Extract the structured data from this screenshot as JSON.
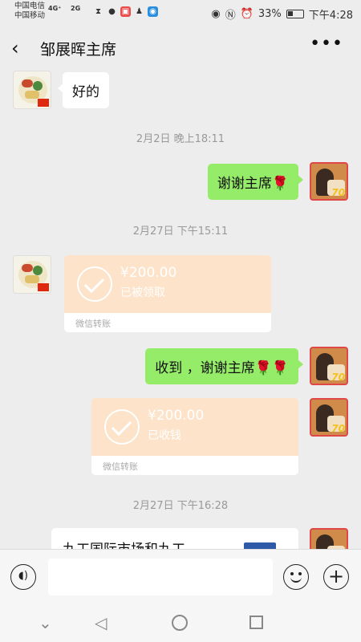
{
  "statusbar": {
    "carrier1": "中国电信",
    "carrier2": "中国移动",
    "net1": "4G⁺",
    "net2": "2G",
    "battery_pct": "33%",
    "time": "下午4:28"
  },
  "header": {
    "title": "邹展晖主席",
    "back_icon": "‹",
    "more_icon": "•••"
  },
  "messages": {
    "m1_text": "好的",
    "ts1": "2月2日 晚上18:11",
    "m2_text": "谢谢主席🌹",
    "ts2": "2月27日 下午15:11",
    "transfer1": {
      "amount": "¥200.00",
      "status": "已被领取",
      "footer": "微信转账"
    },
    "m3_text": "收到 ，谢谢主席🌹🌹",
    "transfer2": {
      "amount": "¥200.00",
      "status": "已收钱",
      "footer": "微信转账"
    },
    "ts3": "2月27日 下午16:28",
    "m4_text": "九工国际市场和九工"
  },
  "input": {
    "placeholder": ""
  },
  "colors": {
    "green_bubble": "#95ec69",
    "transfer_bg": "#fce3c9",
    "background": "#ededed"
  }
}
